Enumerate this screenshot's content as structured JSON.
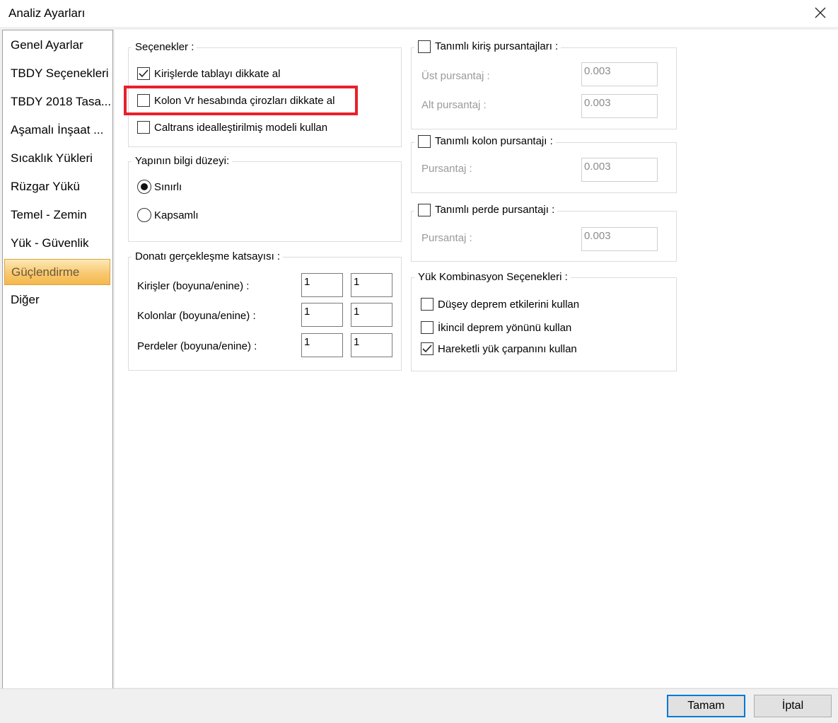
{
  "window": {
    "title": "Analiz Ayarları"
  },
  "sidebar": {
    "items": [
      {
        "label": "Genel Ayarlar"
      },
      {
        "label": "TBDY Seçenekleri"
      },
      {
        "label": "TBDY 2018 Tasa..."
      },
      {
        "label": "Aşamalı İnşaat ..."
      },
      {
        "label": "Sıcaklık Yükleri"
      },
      {
        "label": "Rüzgar Yükü"
      },
      {
        "label": "Temel - Zemin"
      },
      {
        "label": "Yük - Güvenlik"
      },
      {
        "label": "Güçlendirme",
        "selected": true
      },
      {
        "label": "Diğer"
      }
    ]
  },
  "options_group": {
    "title": "Seçenekler :",
    "items": [
      {
        "label": "Kirişlerde tablayı dikkate al",
        "checked": true
      },
      {
        "label": "Kolon Vr hesabında çirozları dikkate al",
        "checked": false,
        "highlighted": true
      },
      {
        "label": "Caltrans idealleştirilmiş modeli kullan",
        "checked": false
      }
    ]
  },
  "knowledge_group": {
    "title": "Yapının bilgi düzeyi:",
    "options": [
      {
        "label": "Sınırlı",
        "selected": true
      },
      {
        "label": "Kapsamlı",
        "selected": false
      }
    ]
  },
  "reinforcement_group": {
    "title": "Donatı gerçekleşme katsayısı :",
    "rows": [
      {
        "label": "Kirişler (boyuna/enine) :",
        "v1": "1",
        "v2": "1"
      },
      {
        "label": "Kolonlar (boyuna/enine) :",
        "v1": "1",
        "v2": "1"
      },
      {
        "label": "Perdeler (boyuna/enine) :",
        "v1": "1",
        "v2": "1"
      }
    ]
  },
  "beam_group": {
    "title": "Tanımlı kiriş pursantajları :",
    "checked": false,
    "top_label": "Üst pursantaj :",
    "top_value": "0.003",
    "bottom_label": "Alt pursantaj :",
    "bottom_value": "0.003"
  },
  "column_group": {
    "title": "Tanımlı kolon pursantajı :",
    "checked": false,
    "label": "Pursantaj :",
    "value": "0.003"
  },
  "wall_group": {
    "title": "Tanımlı perde pursantajı :",
    "checked": false,
    "label": "Pursantaj :",
    "value": "0.003"
  },
  "combination_group": {
    "title": "Yük Kombinasyon Seçenekleri :",
    "items": [
      {
        "label": "Düşey deprem etkilerini kullan",
        "checked": false
      },
      {
        "label": "İkincil deprem yönünü kullan",
        "checked": false
      },
      {
        "label": "Hareketli yük çarpanını kullan",
        "checked": true
      }
    ]
  },
  "footer": {
    "ok_label": "Tamam",
    "cancel_label": "İptal"
  },
  "colors": {
    "highlight": "#e8202a",
    "selected_nav": "#f8c870",
    "focus": "#0078d7"
  }
}
